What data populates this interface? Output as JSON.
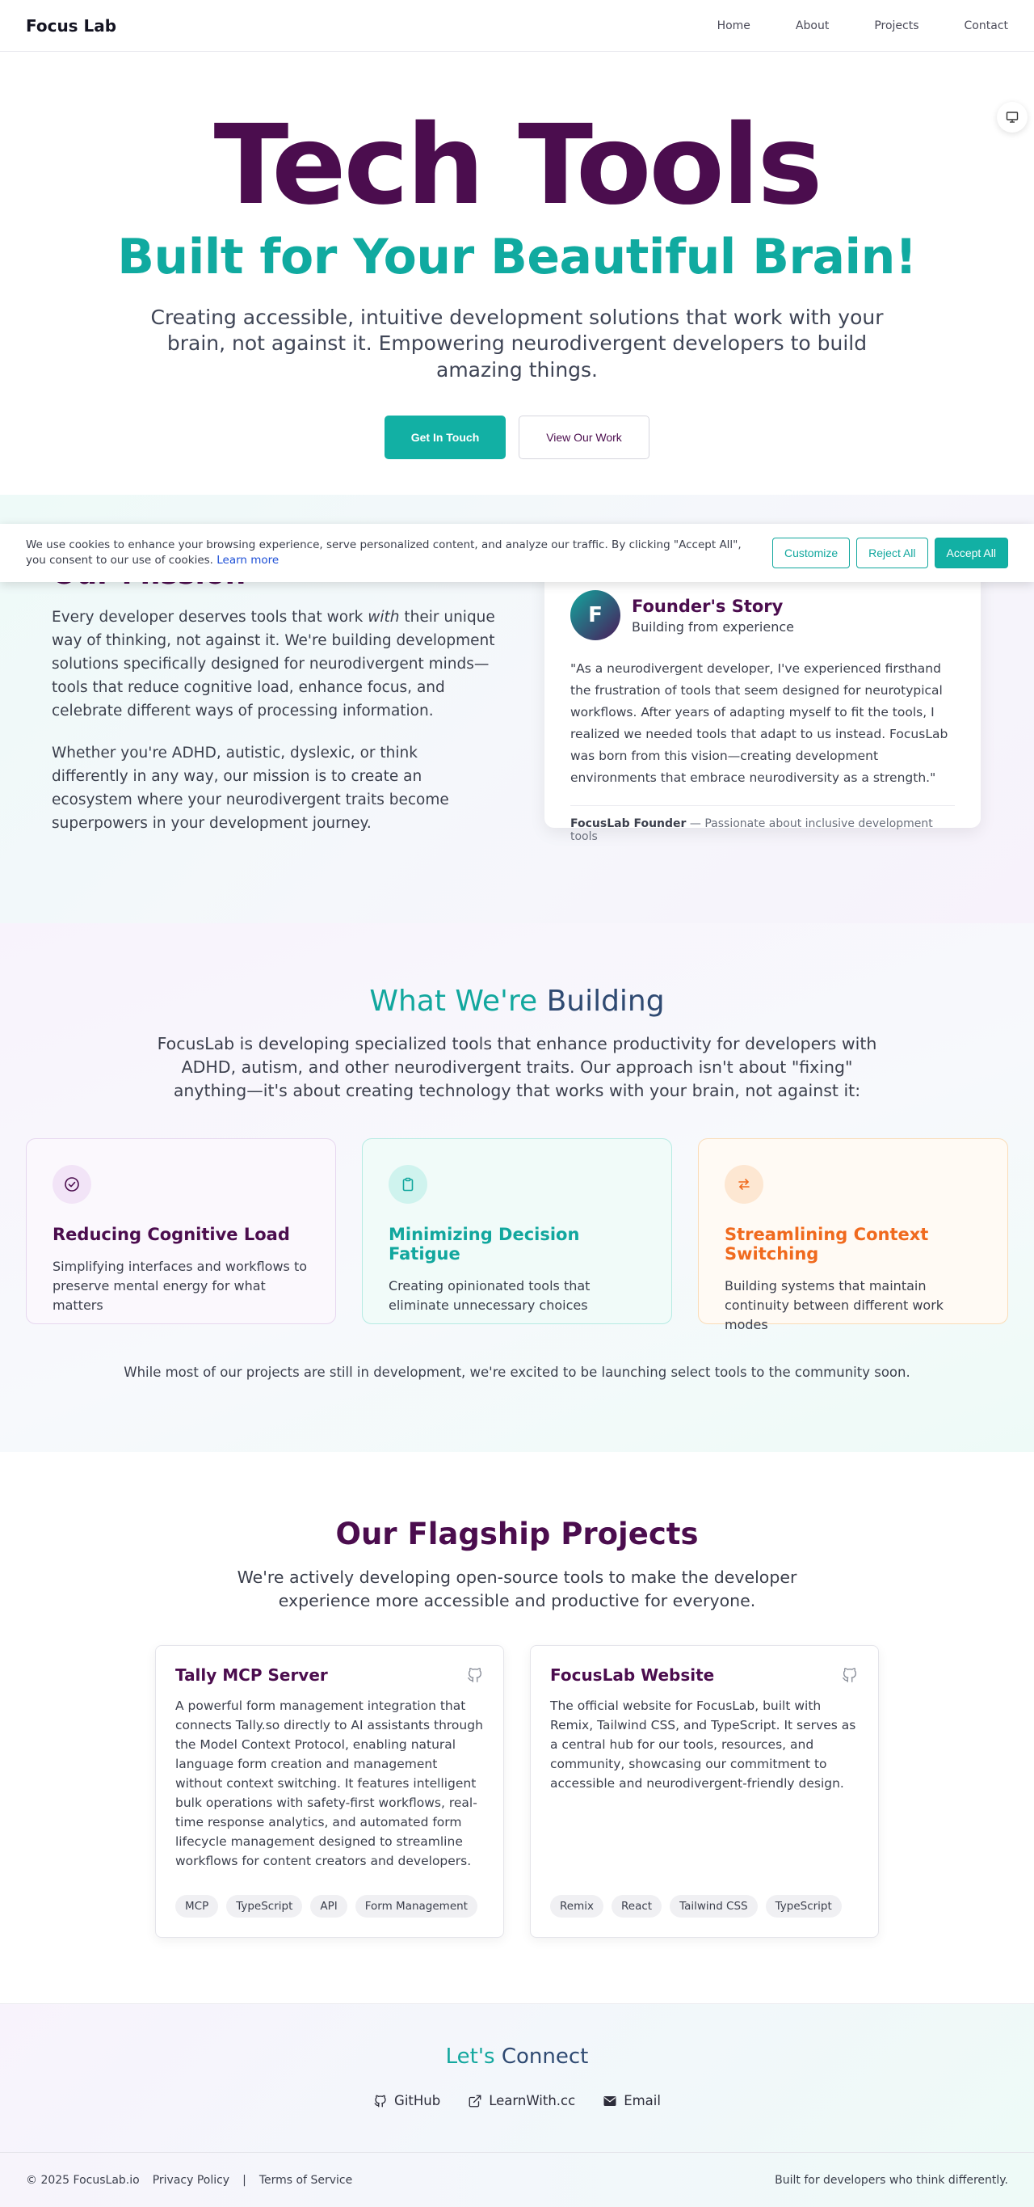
{
  "nav": {
    "brand": "Focus Lab",
    "links": [
      "Home",
      "About",
      "Projects",
      "Contact"
    ]
  },
  "theme_toggle": {
    "icon": "monitor-icon"
  },
  "hero": {
    "title": "Tech Tools",
    "subtitle": "Built for Your Beautiful Brain!",
    "description": "Creating accessible, intuitive development solutions that work with your brain, not against it. Empowering neurodivergent developers to build amazing things.",
    "primary_button": "Get In Touch",
    "secondary_button": "View Our Work"
  },
  "cookie": {
    "text": "We use cookies to enhance your browsing experience, serve personalized content, and analyze our traffic. By clicking \"Accept All\", you consent to our use of cookies.",
    "learn_more": "Learn more",
    "customize": "Customize",
    "reject": "Reject All",
    "accept": "Accept All"
  },
  "mission": {
    "title": "Our Mission",
    "p1_before": "Every developer deserves tools that work ",
    "p1_em": "with",
    "p1_after": " their unique way of thinking, not against it. We're building development solutions specifically designed for neurodivergent minds—tools that reduce cognitive load, enhance focus, and celebrate different ways of processing information.",
    "p2": "Whether you're ADHD, autistic, dyslexic, or think differently in any way, our mission is to create an ecosystem where your neurodivergent traits become superpowers in your development journey.",
    "founder": {
      "avatar_letter": "F",
      "title": "Founder's Story",
      "subtitle": "Building from experience",
      "quote": "\"As a neurodivergent developer, I've experienced firsthand the frustration of tools that seem designed for neurotypical workflows. After years of adapting myself to fit the tools, I realized we needed tools that adapt to us instead. FocusLab was born from this vision—creating development environments that embrace neurodiversity as a strength.\"",
      "name": "FocusLab Founder",
      "tagline": " — Passionate about inclusive development tools"
    }
  },
  "building": {
    "title_a": "What We're ",
    "title_b": "Building",
    "intro": "FocusLab is developing specialized tools that enhance productivity for developers with ADHD, autism, and other neurodivergent traits. Our approach isn't about \"fixing\" anything—it's about creating technology that works with your brain, not against it:",
    "features": [
      {
        "icon": "check-circle-icon",
        "title": "Reducing Cognitive Load",
        "desc": "Simplifying interfaces and workflows to preserve mental energy for what matters"
      },
      {
        "icon": "clipboard-icon",
        "title": "Minimizing Decision Fatigue",
        "desc": "Creating opinionated tools that eliminate unnecessary choices"
      },
      {
        "icon": "arrows-swap-icon",
        "title": "Streamlining Context Switching",
        "desc": "Building systems that maintain continuity between different work modes"
      }
    ],
    "note": "While most of our projects are still in development, we're excited to be launching select tools to the community soon."
  },
  "projects": {
    "title": "Our Flagship Projects",
    "intro": "We're actively developing open-source tools to make the developer experience more accessible and productive for everyone.",
    "items": [
      {
        "title": "Tally MCP Server",
        "desc": "A powerful form management integration that connects Tally.so directly to AI assistants through the Model Context Protocol, enabling natural language form creation and management without context switching. It features intelligent bulk operations with safety-first workflows, real-time response analytics, and automated form lifecycle management designed to streamline workflows for content creators and developers.",
        "tags": [
          "MCP",
          "TypeScript",
          "API",
          "Form Management"
        ]
      },
      {
        "title": "FocusLab Website",
        "desc": "The official website for FocusLab, built with Remix, Tailwind CSS, and TypeScript. It serves as a central hub for our tools, resources, and community, showcasing our commitment to accessible and neurodivergent-friendly design.",
        "tags": [
          "Remix",
          "React",
          "Tailwind CSS",
          "TypeScript"
        ]
      }
    ]
  },
  "connect": {
    "title_a": "Let's ",
    "title_b": "Connect",
    "links": [
      "GitHub",
      "LearnWith.cc",
      "Email"
    ]
  },
  "footer": {
    "copyright": "© 2025 FocusLab.io",
    "privacy": "Privacy Policy",
    "separator": "|",
    "terms": "Terms of Service",
    "tagline": "Built for developers who think differently."
  },
  "colors": {
    "plum": "#4b0d4e",
    "teal": "#12b0a4",
    "orange": "#f06a1e"
  }
}
